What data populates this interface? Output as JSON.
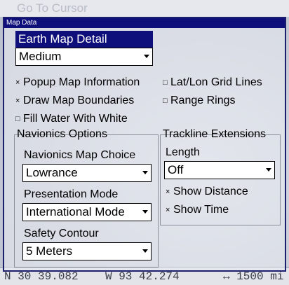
{
  "background": {
    "goto_text": "Go To Cursor",
    "status": {
      "lat": "N  30 39.082",
      "lon": "W  93 42.274",
      "range": "↔ 1500 mi"
    }
  },
  "dialog": {
    "title": "Map Data",
    "earth_map_detail": {
      "label": "Earth Map Detail",
      "value": "Medium"
    },
    "options": {
      "popup_map_information": "Popup Map Information",
      "draw_map_boundaries": "Draw Map Boundaries",
      "fill_water_with_white": "Fill Water With White",
      "lat_lon_grid_lines": "Lat/Lon Grid Lines",
      "range_rings": "Range Rings",
      "checked_mark": "×",
      "unchecked_mark": "□"
    },
    "navionics": {
      "group_label": "Navionics Options",
      "map_choice_label": "Navionics Map Choice",
      "map_choice_value": "Lowrance",
      "presentation_label": "Presentation Mode",
      "presentation_value": "International Mode",
      "safety_label": "Safety Contour",
      "safety_value": "5 Meters"
    },
    "trackline": {
      "group_label": "Trackline Extensions",
      "length_label": "Length",
      "length_value": "Off",
      "show_distance": "Show Distance",
      "show_time": "Show Time"
    }
  }
}
